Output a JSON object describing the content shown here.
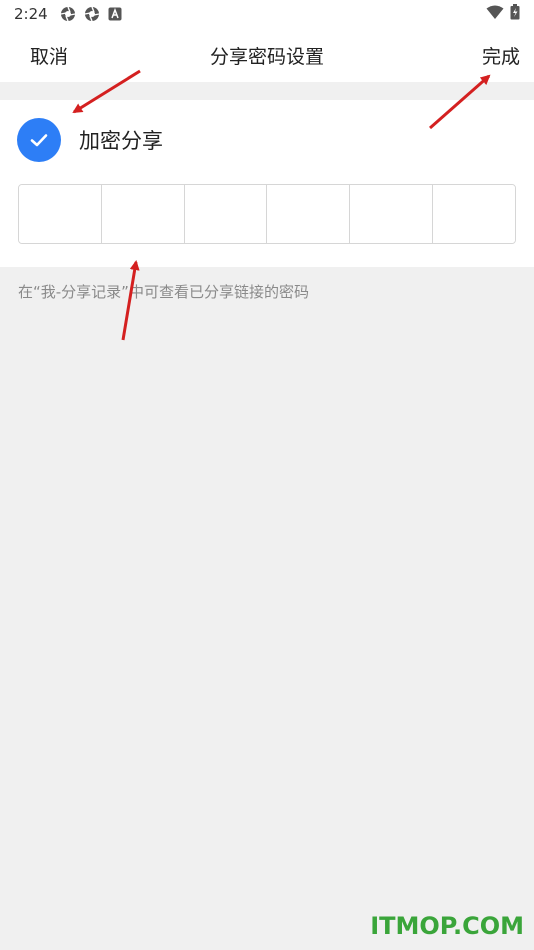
{
  "status_bar": {
    "time": "2:24",
    "left_icons": [
      "aperture-icon",
      "aperture-icon",
      "a-notification-icon"
    ],
    "right_icons": [
      "wifi-icon",
      "battery-icon"
    ]
  },
  "nav": {
    "cancel_label": "取消",
    "title": "分享密码设置",
    "done_label": "完成"
  },
  "encrypt": {
    "checked": true,
    "label": "加密分享",
    "accent_color": "#2d7ef6"
  },
  "password": {
    "cell_count": 6,
    "values": [
      "",
      "",
      "",
      "",
      "",
      ""
    ]
  },
  "hint": "在“我-分享记录”中可查看已分享链接的密码",
  "watermark": "ITMOP.COM"
}
